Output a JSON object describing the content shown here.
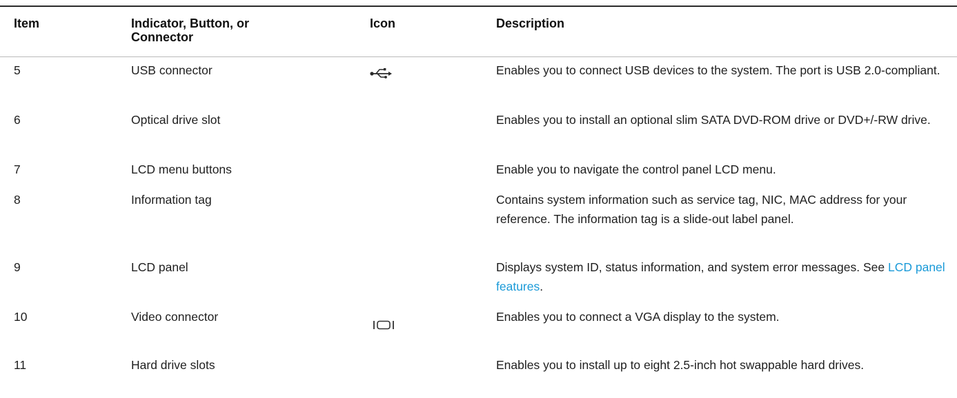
{
  "table": {
    "headers": {
      "item": "Item",
      "name": "Indicator, Button, or Connector",
      "icon": "Icon",
      "description": "Description"
    },
    "rows": [
      {
        "item": "5",
        "name": "USB connector",
        "icon": "usb-icon",
        "description": "Enables you to connect USB devices to the system. The port is USB 2.0-compliant."
      },
      {
        "item": "6",
        "name": "Optical drive slot",
        "icon": "",
        "description": "Enables you to install an optional slim SATA DVD-ROM drive or DVD+/-RW drive."
      },
      {
        "item": "7",
        "name": "LCD menu buttons",
        "icon": "",
        "description": "Enable you to navigate the control panel LCD menu."
      },
      {
        "item": "8",
        "name": "Information tag",
        "icon": "",
        "description": "Contains system information such as service tag, NIC, MAC address for your reference. The information tag is a slide-out label panel."
      },
      {
        "item": "9",
        "name": "LCD panel",
        "icon": "",
        "description_prefix": "Displays system ID, status information, and system error messages. See ",
        "description_link": "LCD panel features",
        "description_suffix": "."
      },
      {
        "item": "10",
        "name": "Video connector",
        "icon": "vga-icon",
        "description": "Enables you to connect a VGA display to the system."
      },
      {
        "item": "11",
        "name": "Hard drive slots",
        "icon": "",
        "description": "Enables you to install up to eight 2.5-inch hot swappable hard drives."
      }
    ]
  },
  "colors": {
    "link": "#1a9ad8",
    "text": "#1f1f1f",
    "rule": "#2b2b2b"
  }
}
